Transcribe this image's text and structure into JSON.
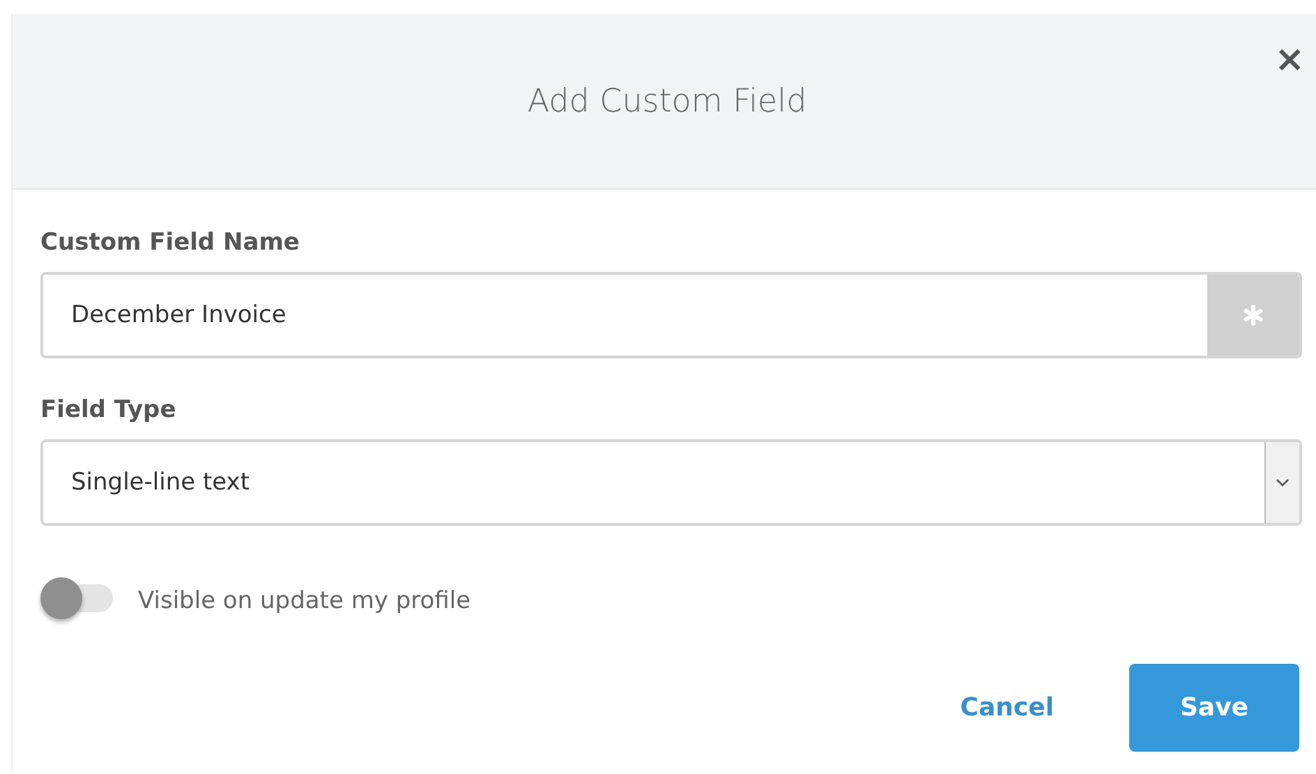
{
  "dialog": {
    "title": "Add Custom Field",
    "close": "×"
  },
  "fields": [
    {
      "kind": "text",
      "label": "Custom Field Name",
      "value": "December Invoice",
      "required": true
    },
    {
      "kind": "select",
      "label": "Field Type",
      "value": "Single-line text"
    }
  ],
  "toggle": {
    "label": "Visible on update my profile",
    "on": false
  },
  "buttons": [
    {
      "kind": "link",
      "label": "Cancel"
    },
    {
      "kind": "primary",
      "label": "Save"
    }
  ]
}
